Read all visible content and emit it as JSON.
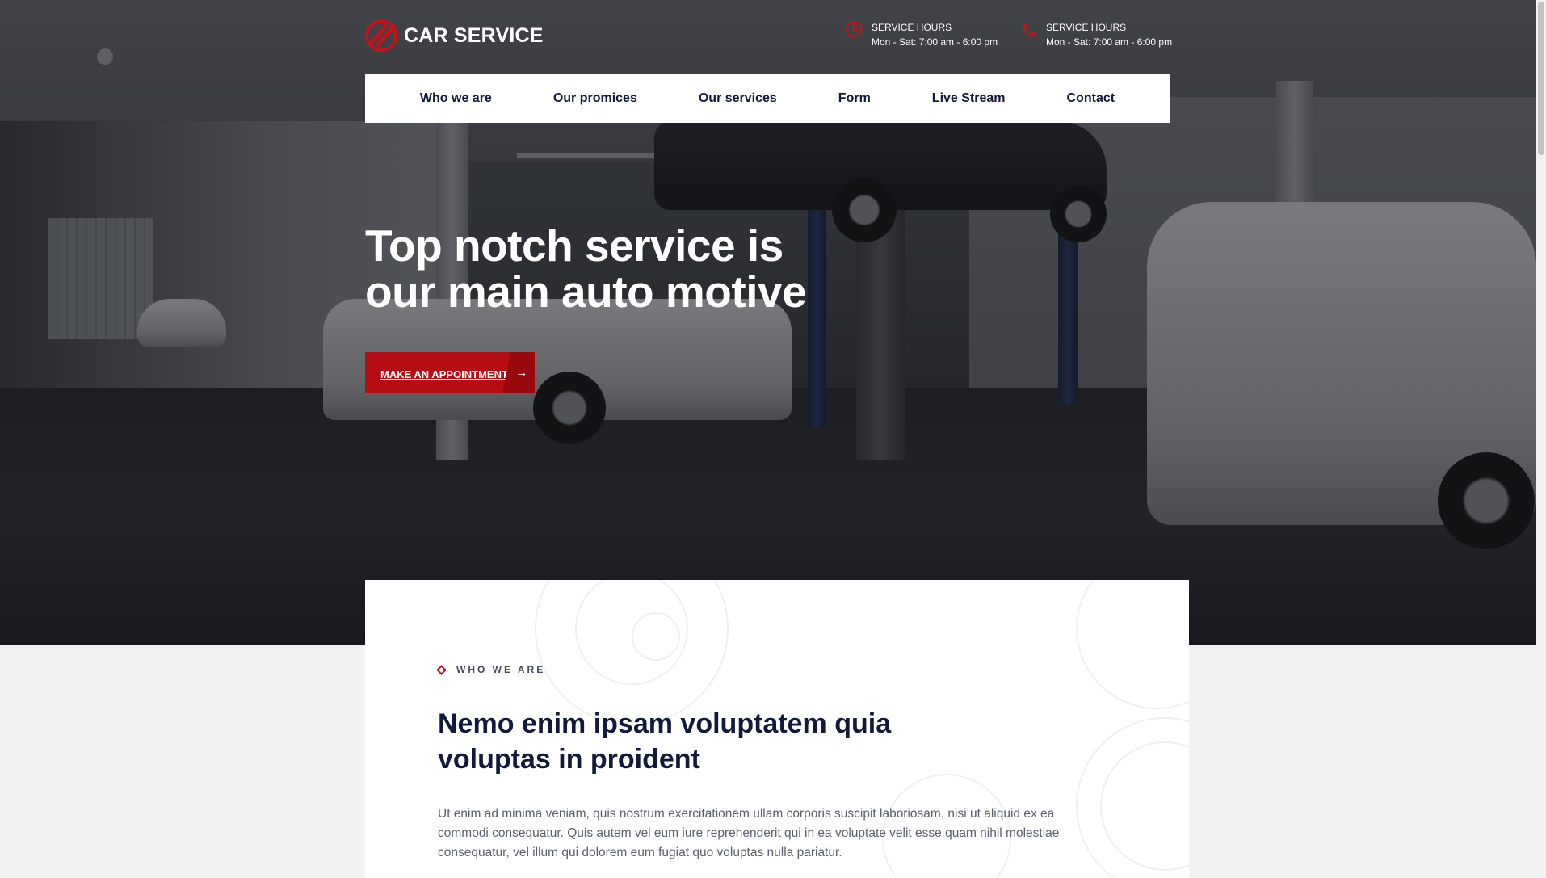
{
  "brand": {
    "name": "CAR SERVICE",
    "accent": "#c3121a"
  },
  "header": {
    "hours": [
      {
        "icon": "clock-icon",
        "label": "SERVICE HOURS",
        "value": "Mon - Sat: 7:00 am - 6:00 pm"
      },
      {
        "icon": "phone-icon",
        "label": "SERVICE HOURS",
        "value": "Mon - Sat: 7:00 am - 6:00 pm"
      }
    ]
  },
  "nav": {
    "items": [
      "Who we are",
      "Our promices",
      "Our services",
      "Form",
      "Live Stream",
      "Contact"
    ]
  },
  "hero": {
    "title_line1": "Top notch service is",
    "title_line2": "our main auto motive",
    "cta_label": "MAKE AN APPOINTMENT",
    "cta_arrow": "→"
  },
  "about": {
    "eyebrow": "WHO WE ARE",
    "title_line1": "Nemo enim ipsam voluptatem quia",
    "title_line2": "voluptas in proident",
    "text": "Ut enim ad minima veniam, quis nostrum exercitationem ullam corporis suscipit laboriosam, nisi ut aliquid ex ea commodi consequatur. Quis autem vel eum iure reprehenderit qui in ea voluptate velit esse quam nihil molestiae consequatur, vel illum qui dolorem eum fugiat quo voluptas nulla pariatur."
  }
}
